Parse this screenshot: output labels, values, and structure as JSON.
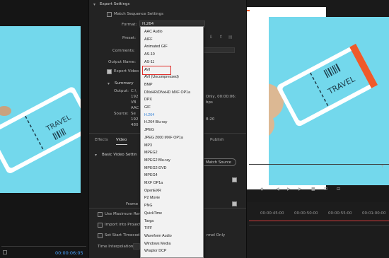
{
  "sequence": {
    "tag_text": "TRAVEL",
    "timecode": "00:00:06:05",
    "ruler": [
      "00:00:45:00",
      "00:00:50:00",
      "00:00:55:00",
      "00:01:00:00"
    ]
  },
  "export_settings": {
    "section_title": "Export Settings",
    "match_sequence_label": "Match Sequence Settings",
    "format_label": "Format:",
    "format_value": "H.264",
    "preset_label": "Preset:",
    "comments_label": "Comments:",
    "output_name_label": "Output Name:",
    "export_video_label": "Export Video"
  },
  "summary": {
    "title": "Summary",
    "output_label": "Output:",
    "output_lines": [
      "C:\\",
      "192",
      "VB",
      "AAC"
    ],
    "output_tail": [
      "Only, 00:00:06:",
      "bps"
    ],
    "source_label": "Source:",
    "source_lines": [
      "Se",
      "192",
      "480"
    ],
    "source_tail": "8:20"
  },
  "tabs": [
    "Effects",
    "Video",
    "Publish"
  ],
  "video_settings": {
    "section_title": "Basic Video Settin",
    "match_source_label": "Match Source",
    "frame_label": "Frame"
  },
  "bottom_options": {
    "use_max_render": "Use Maximum Ren",
    "import_into_project": "Import into Project",
    "set_start_timecode": "Set Start Timecod",
    "render_alpha": "nnel Only",
    "time_interpolation_label": "Time Interpolation:"
  },
  "dropdown": {
    "options": [
      "AAC Audio",
      "AIFF",
      "Animated GIF",
      "AS-10",
      "AS-11",
      "AVI",
      "AVI (Uncompressed)",
      "BMP",
      "DNxHR/DNxHD MXF OP1a",
      "DPX",
      "GIF",
      "H.264",
      "H.264 Blu-ray",
      "JPEG",
      "JPEG 2000 MXF OP1a",
      "MP3",
      "MPEG2",
      "MPEG2 Blu-ray",
      "MPEG2-DVD",
      "MPEG4",
      "MXF OP1a",
      "OpenEXR",
      "P2 Movie",
      "PNG",
      "QuickTime",
      "Targa",
      "TIFF",
      "Waveform Audio",
      "Windows Media",
      "Wraptor DCP"
    ],
    "selected": "H.264",
    "highlighted": "AVI"
  },
  "colors": {
    "accent": "#2f7fd6",
    "highlight_box": "#e0302c",
    "preview_blue": "#73d8ec",
    "ticket_orange": "#ef5a2a",
    "playhead_red": "#d23a3a"
  }
}
